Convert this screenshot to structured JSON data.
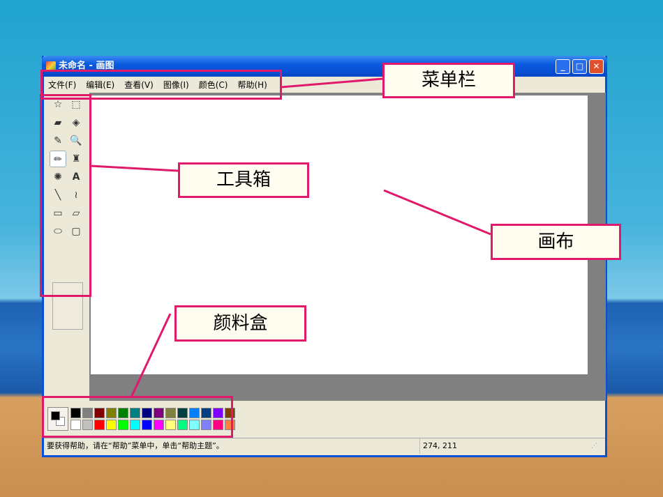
{
  "window": {
    "title": "未命名 - 画图",
    "minimize": "_",
    "maximize": "□",
    "close": "✕"
  },
  "menu": [
    "文件(F)",
    "编辑(E)",
    "查看(V)",
    "图像(I)",
    "颜色(C)",
    "帮助(H)"
  ],
  "tools": [
    {
      "name": "free-select",
      "glyph": "☆"
    },
    {
      "name": "rect-select",
      "glyph": "⬚"
    },
    {
      "name": "eraser",
      "glyph": "▰"
    },
    {
      "name": "fill",
      "glyph": "◈"
    },
    {
      "name": "color-picker",
      "glyph": "✎"
    },
    {
      "name": "magnifier",
      "glyph": "🔍"
    },
    {
      "name": "pencil",
      "glyph": "✏"
    },
    {
      "name": "brush",
      "glyph": "♜"
    },
    {
      "name": "airbrush",
      "glyph": "✺"
    },
    {
      "name": "text",
      "glyph": "A"
    },
    {
      "name": "line",
      "glyph": "╲"
    },
    {
      "name": "curve",
      "glyph": "≀"
    },
    {
      "name": "rectangle",
      "glyph": "▭"
    },
    {
      "name": "polygon",
      "glyph": "▱"
    },
    {
      "name": "ellipse",
      "glyph": "⬭"
    },
    {
      "name": "rounded-rect",
      "glyph": "▢"
    }
  ],
  "selected_tool": "pencil",
  "palette": {
    "top": [
      "#000000",
      "#808080",
      "#800000",
      "#808000",
      "#008000",
      "#008080",
      "#000080",
      "#800080",
      "#808040",
      "#004040",
      "#0080ff",
      "#004080",
      "#8000ff",
      "#804000"
    ],
    "bottom": [
      "#ffffff",
      "#c0c0c0",
      "#ff0000",
      "#ffff00",
      "#00ff00",
      "#00ffff",
      "#0000ff",
      "#ff00ff",
      "#ffff80",
      "#00ff80",
      "#80ffff",
      "#8080ff",
      "#ff0080",
      "#ff8040"
    ],
    "foreground": "#000000",
    "background": "#ffffff"
  },
  "status": {
    "help": "要获得帮助，请在“帮助”菜单中，单击“帮助主题”。",
    "coords": "274, 211"
  },
  "annotations": {
    "menubar": "菜单栏",
    "toolbox": "工具箱",
    "canvas": "画布",
    "palette": "颜料盒"
  },
  "accent": "#e0196a"
}
